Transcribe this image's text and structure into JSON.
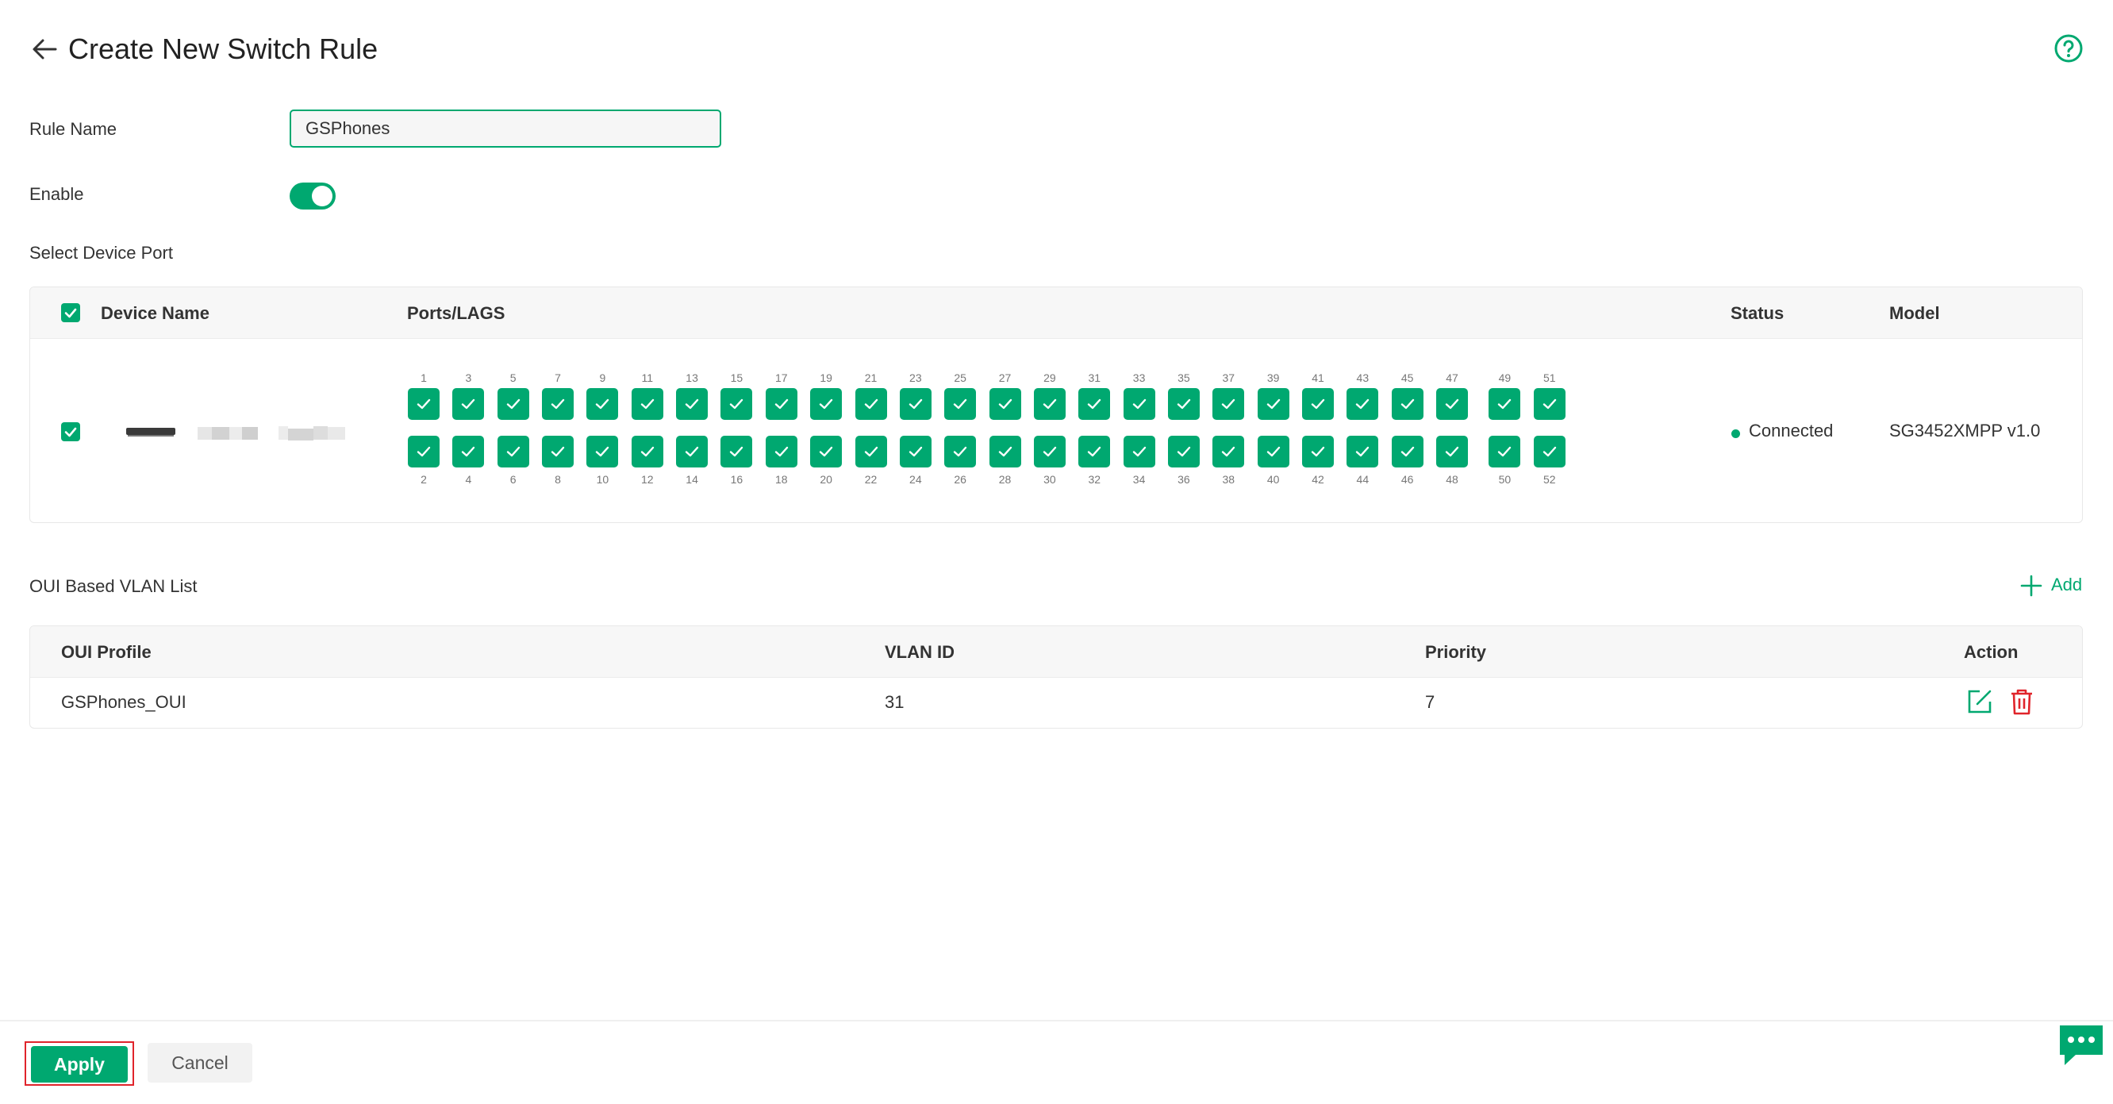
{
  "page": {
    "title": "Create New Switch Rule"
  },
  "colors": {
    "accent": "#00a870",
    "danger": "#e0242b"
  },
  "icons": {
    "back": "arrow-left-icon",
    "help": "question-circle-icon",
    "add": "plus-icon",
    "edit": "edit-icon",
    "delete": "trash-icon",
    "chat": "chat-bubble-icon"
  },
  "form": {
    "rule_name_label": "Rule Name",
    "rule_name_value": "GSPhones",
    "enable_label": "Enable",
    "enable_on": true,
    "select_port_label": "Select Device Port"
  },
  "device_table": {
    "headers": {
      "device_name": "Device Name",
      "ports": "Ports/LAGS",
      "status": "Status",
      "model": "Model"
    },
    "row": {
      "status": "Connected",
      "model": "SG3452XMPP v1.0",
      "ports_top": [
        "1",
        "3",
        "5",
        "7",
        "9",
        "11",
        "13",
        "15",
        "17",
        "19",
        "21",
        "23",
        "25",
        "27",
        "29",
        "31",
        "33",
        "35",
        "37",
        "39",
        "41",
        "43",
        "45",
        "47",
        "49",
        "51"
      ],
      "ports_bottom": [
        "2",
        "4",
        "6",
        "8",
        "10",
        "12",
        "14",
        "16",
        "18",
        "20",
        "22",
        "24",
        "26",
        "28",
        "30",
        "32",
        "34",
        "36",
        "38",
        "40",
        "42",
        "44",
        "46",
        "48",
        "50",
        "52"
      ]
    }
  },
  "oui": {
    "title": "OUI Based VLAN List",
    "add_label": "Add",
    "headers": {
      "profile": "OUI Profile",
      "vlan": "VLAN ID",
      "priority": "Priority",
      "action": "Action"
    },
    "rows": [
      {
        "profile": "GSPhones_OUI",
        "vlan": "31",
        "priority": "7"
      }
    ]
  },
  "footer": {
    "apply_label": "Apply",
    "cancel_label": "Cancel"
  }
}
